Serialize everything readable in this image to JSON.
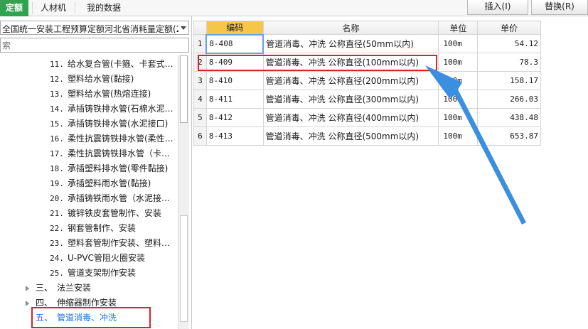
{
  "tabs": [
    {
      "label": "定额",
      "active": true
    },
    {
      "label": "人材机",
      "active": false
    },
    {
      "label": "我的数据",
      "active": false
    }
  ],
  "toolbar": {
    "insert_label": "插入(I)",
    "replace_label": "替换(R)"
  },
  "library_select": {
    "value": "全国统一安装工程预算定额河北省消耗量定额(20"
  },
  "search": {
    "placeholder": "索"
  },
  "tree": {
    "items": [
      {
        "num": "11.",
        "label": "给水复合管(卡箍、卡套式…"
      },
      {
        "num": "12.",
        "label": "塑料给水管(黏接)"
      },
      {
        "num": "13.",
        "label": "塑料给水管(热熔连接)"
      },
      {
        "num": "14.",
        "label": "承插铸铁排水管(石棉水泥…"
      },
      {
        "num": "15.",
        "label": "承插铸铁排水管(水泥接口)"
      },
      {
        "num": "16.",
        "label": "柔性抗震铸铁排水管(柔性…"
      },
      {
        "num": "17.",
        "label": "柔性抗震铸铁排水管（卡…"
      },
      {
        "num": "18.",
        "label": "承插塑料排水管(零件黏接)"
      },
      {
        "num": "19.",
        "label": "承插塑料雨水管(黏接)"
      },
      {
        "num": "20.",
        "label": "承插铸铁雨水管（水泥接…"
      },
      {
        "num": "21.",
        "label": "镀锌铁皮套管制作、安装"
      },
      {
        "num": "22.",
        "label": "钢套管制作、安装"
      },
      {
        "num": "23.",
        "label": "塑料套管制作安装、塑料…"
      },
      {
        "num": "24.",
        "label": "U-PVC管阻火圈安装"
      },
      {
        "num": "25.",
        "label": "管道支架制作安装"
      }
    ],
    "groups": [
      {
        "num": "三、",
        "label": "法兰安装"
      },
      {
        "num": "四、",
        "label": "伸缩器制作安装"
      },
      {
        "num": "五、",
        "label": "管道消毒、冲洗"
      }
    ]
  },
  "grid": {
    "headers": {
      "code": "编码",
      "name": "名称",
      "unit": "单位",
      "price": "单价"
    },
    "rows": [
      {
        "idx": "1",
        "code": "8-408",
        "name": "管道消毒、冲洗 公称直径(50mm以内)",
        "unit": "100m",
        "price": "54.12"
      },
      {
        "idx": "2",
        "code": "8-409",
        "name": "管道消毒、冲洗 公称直径(100mm以内)",
        "unit": "100m",
        "price": "78.3"
      },
      {
        "idx": "3",
        "code": "8-410",
        "name": "管道消毒、冲洗 公称直径(200mm以内)",
        "unit": "100m",
        "price": "158.17"
      },
      {
        "idx": "4",
        "code": "8-411",
        "name": "管道消毒、冲洗 公称直径(300mm以内)",
        "unit": "100m",
        "price": "266.03"
      },
      {
        "idx": "5",
        "code": "8-412",
        "name": "管道消毒、冲洗 公称直径(400mm以内)",
        "unit": "100m",
        "price": "438.48"
      },
      {
        "idx": "6",
        "code": "8-413",
        "name": "管道消毒、冲洗 公称直径(500mm以内)",
        "unit": "100m",
        "price": "653.87"
      }
    ]
  },
  "colors": {
    "accent": "#2ea44f",
    "highlight_box": "#e1212a",
    "annotation_arrow": "#3b8fe0",
    "selected_text": "#1e6fd9",
    "code_header": "#f5c64a"
  }
}
